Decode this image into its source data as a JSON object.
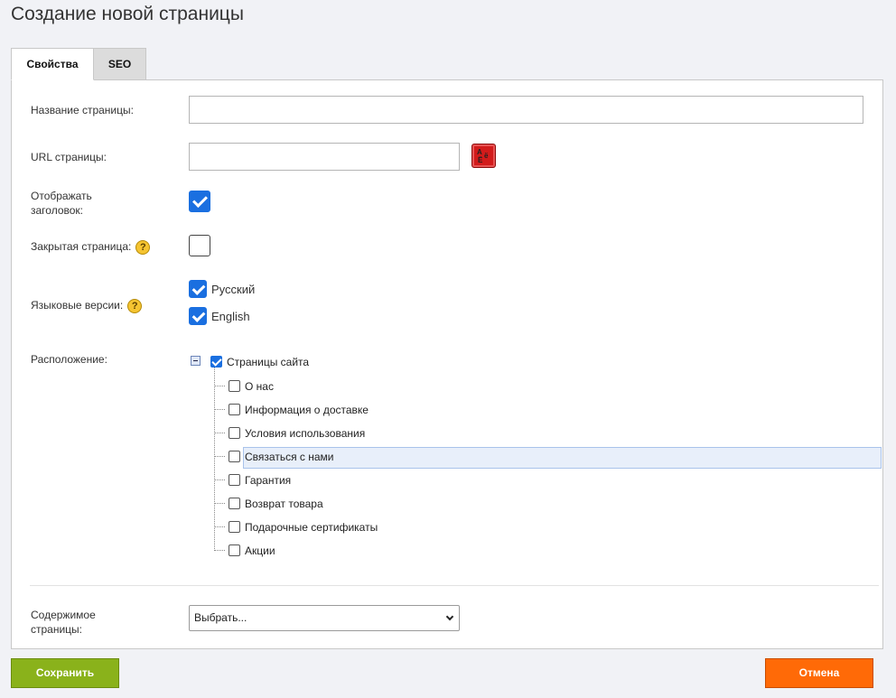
{
  "page": {
    "title": "Создание новой страницы"
  },
  "tabs": [
    {
      "label": "Свойства",
      "active": true
    },
    {
      "label": "SEO",
      "active": false
    }
  ],
  "form": {
    "page_name": {
      "label": "Название страницы:",
      "value": ""
    },
    "page_url": {
      "label": "URL страницы:",
      "value": "",
      "translit_icon": "translit-icon"
    },
    "show_title": {
      "label_line1": "Отображать",
      "label_line2": "заголовок:",
      "checked": true
    },
    "closed_page": {
      "label": "Закрытая страница:",
      "help_icon": "?",
      "checked": false
    },
    "languages": {
      "label": "Языковые версии:",
      "help_icon": "?",
      "options": [
        {
          "label": "Русский",
          "checked": true
        },
        {
          "label": "English",
          "checked": true
        }
      ]
    },
    "location": {
      "label": "Расположение:",
      "root": {
        "label": "Страницы сайта",
        "checked": true,
        "expanded": true
      },
      "children": [
        {
          "label": "О нас",
          "checked": false
        },
        {
          "label": "Информация о доставке",
          "checked": false
        },
        {
          "label": "Условия использования",
          "checked": false
        },
        {
          "label": "Связаться с нами",
          "checked": false,
          "selected": true
        },
        {
          "label": "Гарантия",
          "checked": false
        },
        {
          "label": "Возврат товара",
          "checked": false
        },
        {
          "label": "Подарочные сертификаты",
          "checked": false
        },
        {
          "label": "Акции",
          "checked": false
        }
      ]
    },
    "content": {
      "label_line1": "Содержимое",
      "label_line2": "страницы:",
      "selected": "Выбрать..."
    }
  },
  "actions": {
    "save_label": "Сохранить",
    "cancel_label": "Отмена"
  },
  "colors": {
    "save": "#8ab21b",
    "cancel": "#ff6a07",
    "checkbox": "#1a6fe0"
  }
}
